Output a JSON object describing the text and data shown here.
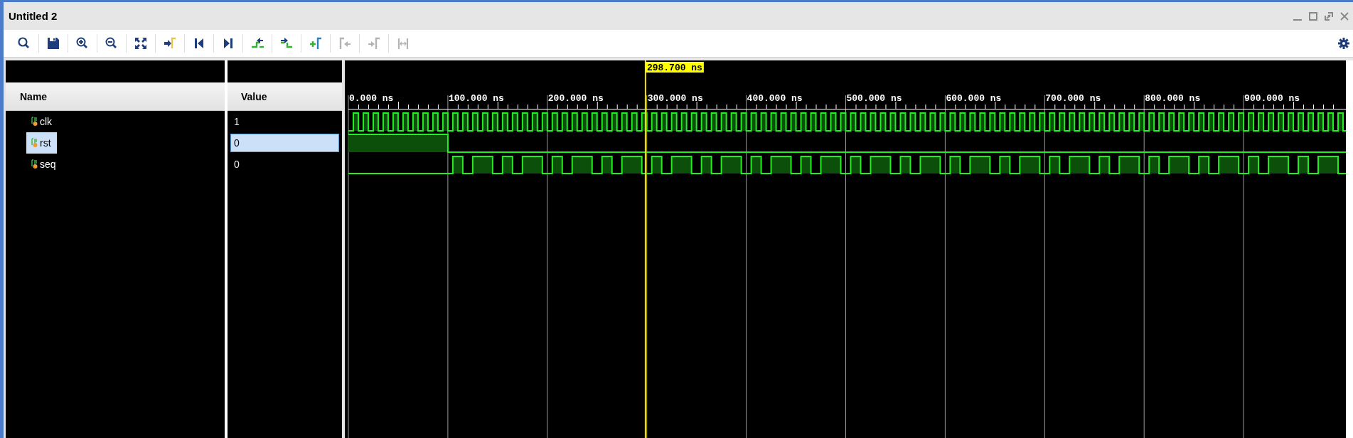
{
  "window": {
    "title": "Untitled 2"
  },
  "toolbar": [
    {
      "kind": "search",
      "disabled": false
    },
    {
      "kind": "save",
      "disabled": false
    },
    {
      "kind": "zoom-in",
      "disabled": false
    },
    {
      "kind": "zoom-out",
      "disabled": false
    },
    {
      "kind": "zoom-fit",
      "disabled": false
    },
    {
      "kind": "go-to-cursor",
      "disabled": false
    },
    {
      "kind": "go-to-start",
      "disabled": false
    },
    {
      "kind": "go-to-end",
      "disabled": false
    },
    {
      "kind": "previous-transition",
      "disabled": false
    },
    {
      "kind": "next-transition",
      "disabled": false
    },
    {
      "kind": "add-marker",
      "disabled": false
    },
    {
      "kind": "previous-marker",
      "disabled": true
    },
    {
      "kind": "next-marker",
      "disabled": true
    },
    {
      "kind": "swap-cursors",
      "disabled": true
    }
  ],
  "columns": {
    "name": "Name",
    "value": "Value"
  },
  "signals": [
    {
      "name": "clk",
      "value": "1",
      "selected": false,
      "kind": "clock"
    },
    {
      "name": "rst",
      "value": "0",
      "selected": true,
      "kind": "reset"
    },
    {
      "name": "seq",
      "value": "0",
      "selected": false,
      "kind": "pattern"
    }
  ],
  "timeline": {
    "ticks": [
      "0.000 ns",
      "100.000 ns",
      "200.000 ns",
      "300.000 ns",
      "400.000 ns",
      "500.000 ns",
      "600.000 ns",
      "700.000 ns",
      "800.000 ns",
      "900.000 ns"
    ],
    "cursor": "298.700 ns"
  }
}
